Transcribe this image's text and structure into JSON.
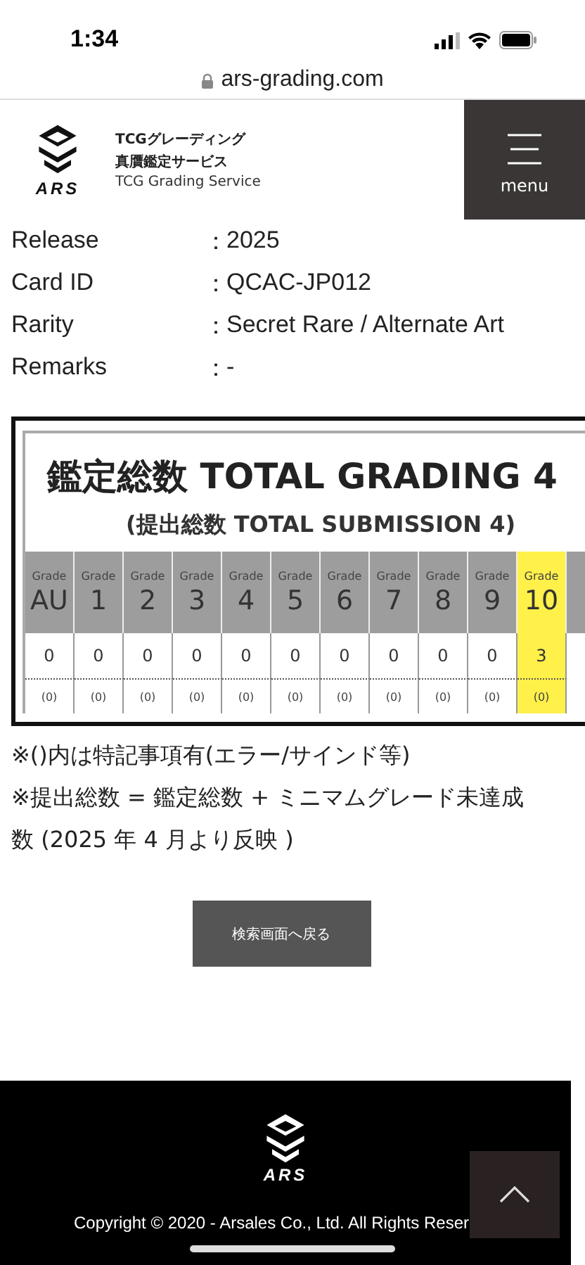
{
  "status_bar": {
    "time": "1:34"
  },
  "url": "ars-grading.com",
  "header": {
    "logo_text": "ARS",
    "brand_lines": [
      "TCGグレーディング",
      "真贋鑑定サービス"
    ],
    "tagline": "TCG Grading Service",
    "menu_label": "menu"
  },
  "details": [
    {
      "label": "Release",
      "colon": "：",
      "value": "2025"
    },
    {
      "label": "Card ID",
      "colon": "：",
      "value": "QCAC-JP012"
    },
    {
      "label": "Rarity",
      "colon": "：",
      "value": "Secret Rare / Alternate Art"
    },
    {
      "label": "Remarks",
      "colon": "：",
      "value": "-"
    }
  ],
  "grading": {
    "title": "鑑定総数 TOTAL GRADING 4",
    "subtitle": "(提出総数 TOTAL SUBMISSION 4)",
    "grades": [
      {
        "caption": "Grade",
        "grade": "AU",
        "count": "0",
        "special": "(0)",
        "highlighted": false
      },
      {
        "caption": "Grade",
        "grade": "1",
        "count": "0",
        "special": "(0)",
        "highlighted": false
      },
      {
        "caption": "Grade",
        "grade": "2",
        "count": "0",
        "special": "(0)",
        "highlighted": false
      },
      {
        "caption": "Grade",
        "grade": "3",
        "count": "0",
        "special": "(0)",
        "highlighted": false
      },
      {
        "caption": "Grade",
        "grade": "4",
        "count": "0",
        "special": "(0)",
        "highlighted": false
      },
      {
        "caption": "Grade",
        "grade": "5",
        "count": "0",
        "special": "(0)",
        "highlighted": false
      },
      {
        "caption": "Grade",
        "grade": "6",
        "count": "0",
        "special": "(0)",
        "highlighted": false
      },
      {
        "caption": "Grade",
        "grade": "7",
        "count": "0",
        "special": "(0)",
        "highlighted": false
      },
      {
        "caption": "Grade",
        "grade": "8",
        "count": "0",
        "special": "(0)",
        "highlighted": false
      },
      {
        "caption": "Grade",
        "grade": "9",
        "count": "0",
        "special": "(0)",
        "highlighted": false
      },
      {
        "caption": "Grade",
        "grade": "10",
        "count": "3",
        "special": "(0)",
        "highlighted": true
      }
    ]
  },
  "notes": [
    "※()内は特記事項有(エラー/サインド等)",
    "※提出総数 = 鑑定総数 + ミニマムグレード未達成数 (2025 年 4 月より反映 )"
  ],
  "back_button": "検索画面へ戻る",
  "footer": {
    "logo_text": "ARS",
    "copyright": "Copyright © 2020 - Arsales Co., Ltd. All Rights Reser"
  }
}
